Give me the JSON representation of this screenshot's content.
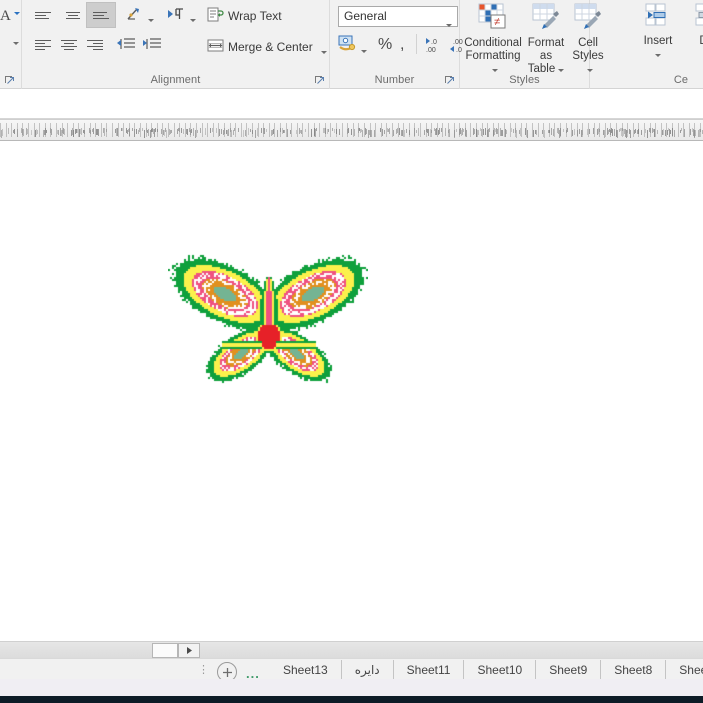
{
  "ribbon": {
    "groups": [
      {
        "name": "font",
        "label": ""
      },
      {
        "name": "alignment",
        "label": "Alignment"
      },
      {
        "name": "number",
        "label": "Number"
      },
      {
        "name": "styles",
        "label": "Styles"
      },
      {
        "name": "cells",
        "label": "Ce"
      }
    ],
    "font": {
      "font_color_letter": "A"
    },
    "alignment": {
      "wrap_text_label": "Wrap Text",
      "merge_center_label": "Merge & Center",
      "align_top_icon": "align-top-icon",
      "align_middle_icon": "align-middle-icon",
      "align_bottom_icon": "align-bottom-icon",
      "orientation_icon": "orientation-icon",
      "text_direction_icon": "text-direction-icon",
      "align_left_icon": "align-left-icon",
      "align_center_icon": "align-center-icon",
      "align_right_icon": "align-right-icon",
      "decrease_indent_icon": "decrease-indent-icon",
      "increase_indent_icon": "increase-indent-icon",
      "wrap_text_icon": "wrap-text-icon",
      "merge_center_icon": "merge-center-icon",
      "dialog_launcher_icon": "dialog-launcher-icon"
    },
    "number": {
      "format_value": "General",
      "format_options": [
        "General"
      ],
      "accounting_icon": "accounting-format-icon",
      "percent_label": "%",
      "comma_label": ",",
      "increase_decimal_label": ".00",
      "decrease_decimal_label": ".00",
      "dialog_launcher_icon": "dialog-launcher-icon"
    },
    "styles": {
      "conditional_formatting_line1": "Conditional",
      "conditional_formatting_line2": "Formatting",
      "format_as_table_line1": "Format as",
      "format_as_table_line2": "Table",
      "cell_styles_line1": "Cell",
      "cell_styles_line2": "Styles",
      "conditional_formatting_icon": "conditional-formatting-icon",
      "format_as_table_icon": "format-as-table-icon",
      "cell_styles_icon": "cell-styles-icon"
    },
    "cells": {
      "insert_label": "Insert",
      "delete_label": "Del",
      "insert_icon": "insert-cells-icon",
      "delete_icon": "delete-cells-icon"
    }
  },
  "sheet_tabs": {
    "first_icon": "first-sheet-icon",
    "next_icon": "next-sheet-icon",
    "handle_icon": "tab-split-handle-icon",
    "add_sheet_icon": "add-sheet-icon",
    "add_sheet_label": "+",
    "overflow_label": "...",
    "tabs": [
      {
        "label": "Sheet13",
        "active": false
      },
      {
        "label": "دایره",
        "active": false,
        "rtl": true
      },
      {
        "label": "Sheet11",
        "active": false
      },
      {
        "label": "Sheet10",
        "active": false
      },
      {
        "label": "Sheet9",
        "active": false
      },
      {
        "label": "Sheet8",
        "active": false
      },
      {
        "label": "Shee",
        "active": false
      }
    ]
  },
  "artwork": {
    "name": "butterfly-pixel-art",
    "description": "Butterfly rendered from conditionally formatted spreadsheet cells",
    "palette": {
      "green": "#0FA03C",
      "yellow": "#FBF14C",
      "pink": "#EF5180",
      "orange": "#E1901F",
      "teal": "#74B493",
      "red": "#E62128",
      "white": "#FFFFFF"
    },
    "cell": 2,
    "cols": 100,
    "rows": 84
  },
  "colors": {
    "ribbon_bg": "#F1F1F1",
    "grid_bg": "#FFFFFF",
    "tabbar_bg": "#F1F1F1",
    "statusbar_bg": "#F0EEF3",
    "taskbar_bg": "#0D1B26",
    "accent_blue": "#2B72C1"
  }
}
